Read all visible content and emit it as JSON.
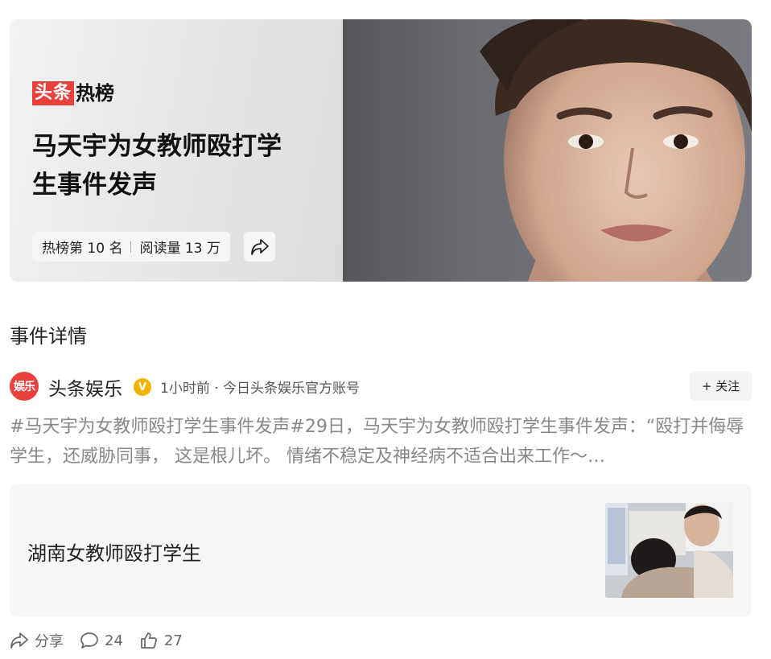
{
  "hero": {
    "brand_red": "头条",
    "brand_black": "热榜",
    "title": "马天宇为女教师殴打学生事件发声",
    "rank": "热榜第 10 名",
    "reads": "阅读量 13 万",
    "share_icon": "share-icon"
  },
  "section": {
    "title": "事件详情"
  },
  "author": {
    "avatar_text": "娱乐",
    "name": "头条娱乐",
    "verified_badge": "V",
    "meta": "1小时前 · 今日头条娱乐官方账号",
    "follow_label": "+ 关注"
  },
  "excerpt": "#马天宇为女教师殴打学生事件发声#29日，马天宇为女教师殴打学生事件发声：“殴打并侮辱学生，还威胁同事， 这是根儿坏。 情绪不稳定及神经病不适合出来工作～…",
  "link_card": {
    "title": "湖南女教师殴打学生"
  },
  "actions": {
    "share_label": "分享",
    "comment_count": "24",
    "like_count": "27"
  },
  "colors": {
    "brand_red": "#e8413b",
    "verified_yellow": "#f0b400"
  }
}
